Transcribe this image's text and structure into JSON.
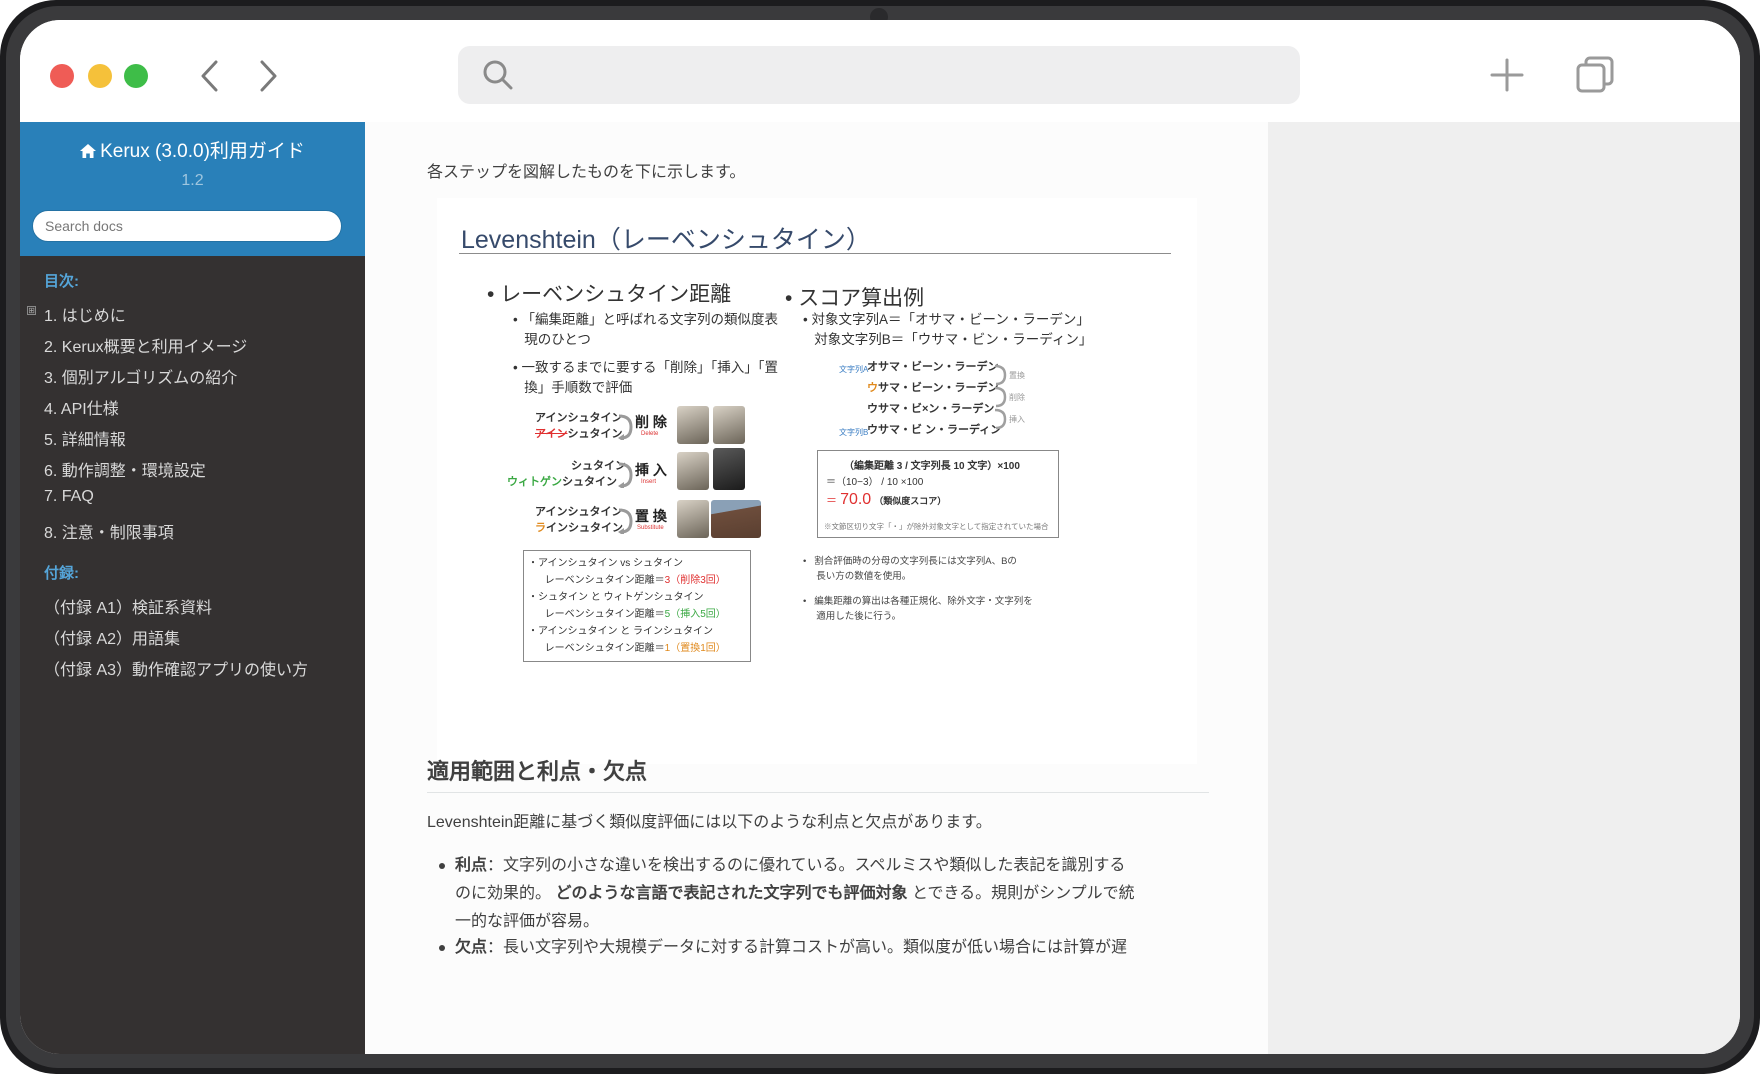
{
  "browser": {
    "window_controls": [
      "close",
      "minimize",
      "zoom"
    ],
    "nav": {
      "back_icon": "chevron-left-icon",
      "forward_icon": "chevron-right-icon"
    },
    "search": {
      "placeholder": "",
      "value": ""
    },
    "actions": {
      "new_tab_icon": "plus-icon",
      "tabs_icon": "tabs-icon"
    }
  },
  "sidebar": {
    "title": "Kerux (3.0.0)利用ガイド",
    "version": "1.2",
    "search_placeholder": "Search docs",
    "toc_caption": "目次:",
    "toc_items": [
      "1. はじめに",
      "2. Kerux概要と利用イメージ",
      "3. 個別アルゴリズムの紹介",
      "4. API仕様",
      "5. 詳細情報",
      "6. 動作調整・環境設定",
      "7. FAQ",
      "8. 注意・制限事項"
    ],
    "appendix_caption": "付録:",
    "appendix_items": [
      "（付録 A1）検証系資料",
      "（付録 A2）用語集",
      "（付録 A3）動作確認アプリの使い方"
    ]
  },
  "content": {
    "intro": "各ステップを図解したものを下に示します。",
    "slide": {
      "title": "Levenshtein（レーベンシュタイン）",
      "left_heading": "レーベンシュタイン距離",
      "left_bullet1_line1": "「編集距離」と呼ばれる文字列の類似度表",
      "left_bullet1_line2": "現のひとつ",
      "left_bullet2_line1": "一致するまでに要する「削除」「挿入」「置",
      "left_bullet2_line2": "換」手順数で評価",
      "ops": [
        {
          "top": "アインシュタイン",
          "bottom_struck": "アイン",
          "bottom_rest": "シュタイン",
          "verb": "削 除",
          "verb_en": "Delete"
        },
        {
          "top": "シュタイン",
          "bottom_added": "ウィトゲン",
          "bottom_rest": "シュタイン",
          "verb": "挿 入",
          "verb_en": "Insert"
        },
        {
          "top": "アインシュタイン",
          "bottom_changed": "ラ",
          "bottom_rest": "インシュタイン",
          "verb": "置 換",
          "verb_en": "Substitute"
        }
      ],
      "summary": [
        {
          "pair": "・アインシュタイン vs シュタイン",
          "dist_label": "レーベンシュタイン距離＝",
          "dist_value": "3",
          "detail": "（削除3回）"
        },
        {
          "pair": "・シュタイン と ウィトゲンシュタイン",
          "dist_label": "レーベンシュタイン距離＝",
          "dist_value": "5",
          "detail": "（挿入5回）"
        },
        {
          "pair": "・アインシュタイン と ラインシュタイン",
          "dist_label": "レーベンシュタイン距離＝",
          "dist_value": "1",
          "detail": "（置換1回）"
        }
      ],
      "right_heading": "スコア算出例",
      "target_a": "対象文字列A＝「オサマ・ビーン・ラーデン」",
      "target_b": "対象文字列B＝「ウサマ・ビン・ラーディン」",
      "steps": [
        {
          "tag": "文字列A",
          "text": "オサマ・ビーン・ラーデン",
          "op": "置換"
        },
        {
          "tag": "",
          "text_changed": "ウ",
          "text": "サマ・ビーン・ラーデン",
          "op": "削除"
        },
        {
          "tag": "",
          "text": "ウサマ・ビ×ン・ラーデン",
          "op": "挿入"
        },
        {
          "tag": "文字列B",
          "text": "ウサマ・ビ ン・ラーディン",
          "op": ""
        }
      ],
      "formula_line1": "（編集距離 3 / 文字列長 10 文字）×100",
      "formula_line2": "＝（10−3） / 10 ×100",
      "formula_eq": "＝",
      "score_value": "70.0",
      "score_label": "（類似度スコア）",
      "formula_note": "※文節区切り文字「・」が除外対象文字として指定されていた場合",
      "note1_line1": "割合評価時の分母の文字列長には文字列A、Bの",
      "note1_line2": "長い方の数値を使用。",
      "note2_line1": "編集距離の算出は各種正規化、除外文字・文字列を",
      "note2_line2": "適用した後に行う。"
    },
    "heading": "適用範囲と利点・欠点",
    "paragraph": "Levenshtein距離に基づく類似度評価には以下のような利点と欠点があります。",
    "pros_label": "利点",
    "pros_text1": "：文字列の小さな違いを検出するのに優れている。スペルミスや類似した表記を識別する",
    "pros_text2": "のに効果的。",
    "pros_bold": "どのような言語で表記された文字列でも評価対象",
    "pros_text3": "とできる。規則がシンプルで統",
    "pros_text4": "一的な評価が容易。",
    "cons_label": "欠点",
    "cons_text": "：長い文字列や大規模データに対する計算コストが高い。類似度が低い場合には計算が遅"
  }
}
